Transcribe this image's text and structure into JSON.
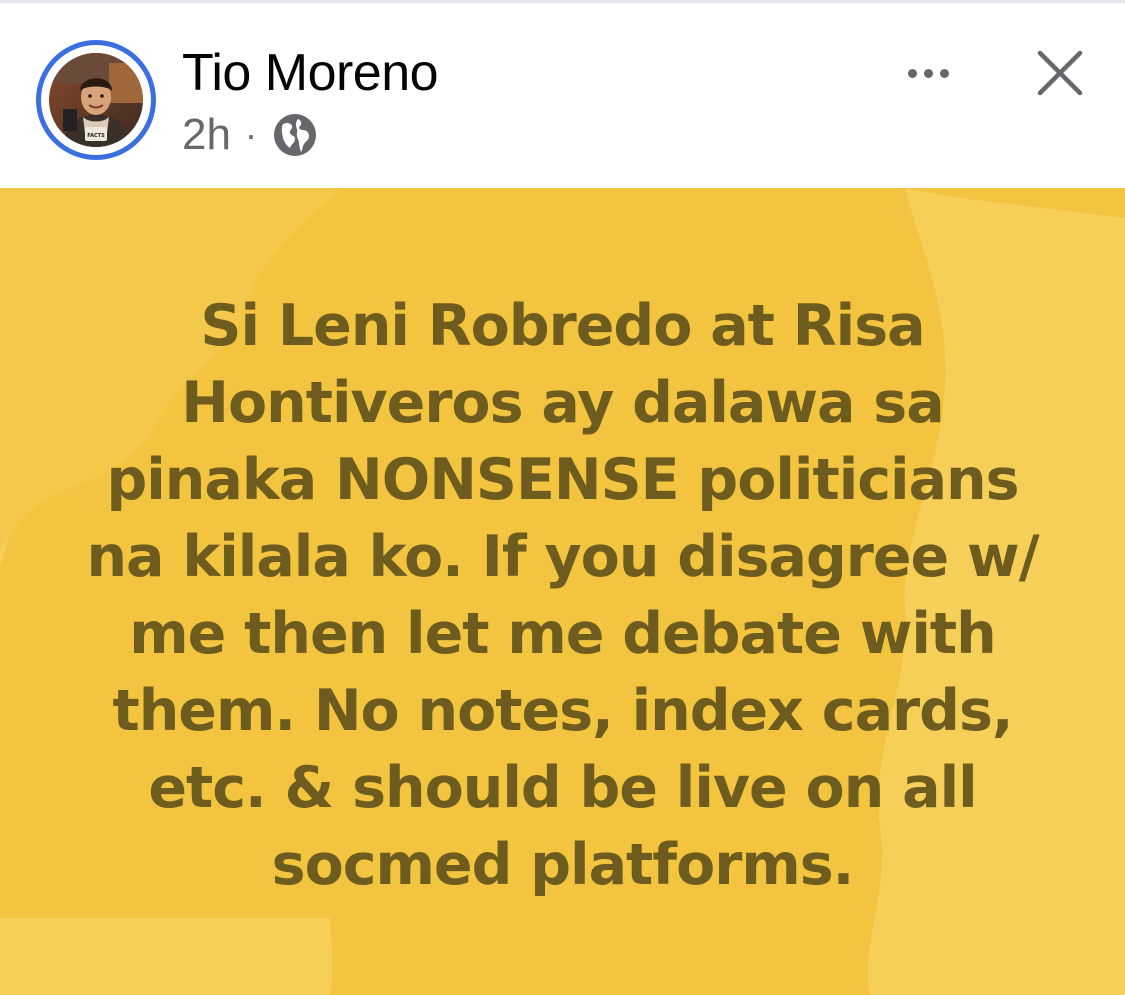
{
  "post": {
    "author": {
      "name": "Tio Moreno",
      "avatar_badge_text": "FACTS"
    },
    "timestamp": "2h",
    "separator": "·",
    "audience_icon": "globe-icon",
    "actions": {
      "more_icon": "more-dots-icon",
      "close_icon": "close-icon"
    },
    "text_lines": [
      "Si Leni Robredo at Risa",
      "Hontiveros ay dalawa sa",
      "pinaka NONSENSE politicians",
      "na kilala ko. If you disagree w/",
      "me then let me debate with",
      "them. No notes, index cards,",
      "etc. & should be live on all",
      "socmed platforms."
    ],
    "colors": {
      "background_yellow": "#f6cf58",
      "background_shade": "#f2c43f",
      "text": "#6e5c1f",
      "avatar_ring": "#3b6fe0",
      "secondary_text": "#65676b"
    }
  }
}
